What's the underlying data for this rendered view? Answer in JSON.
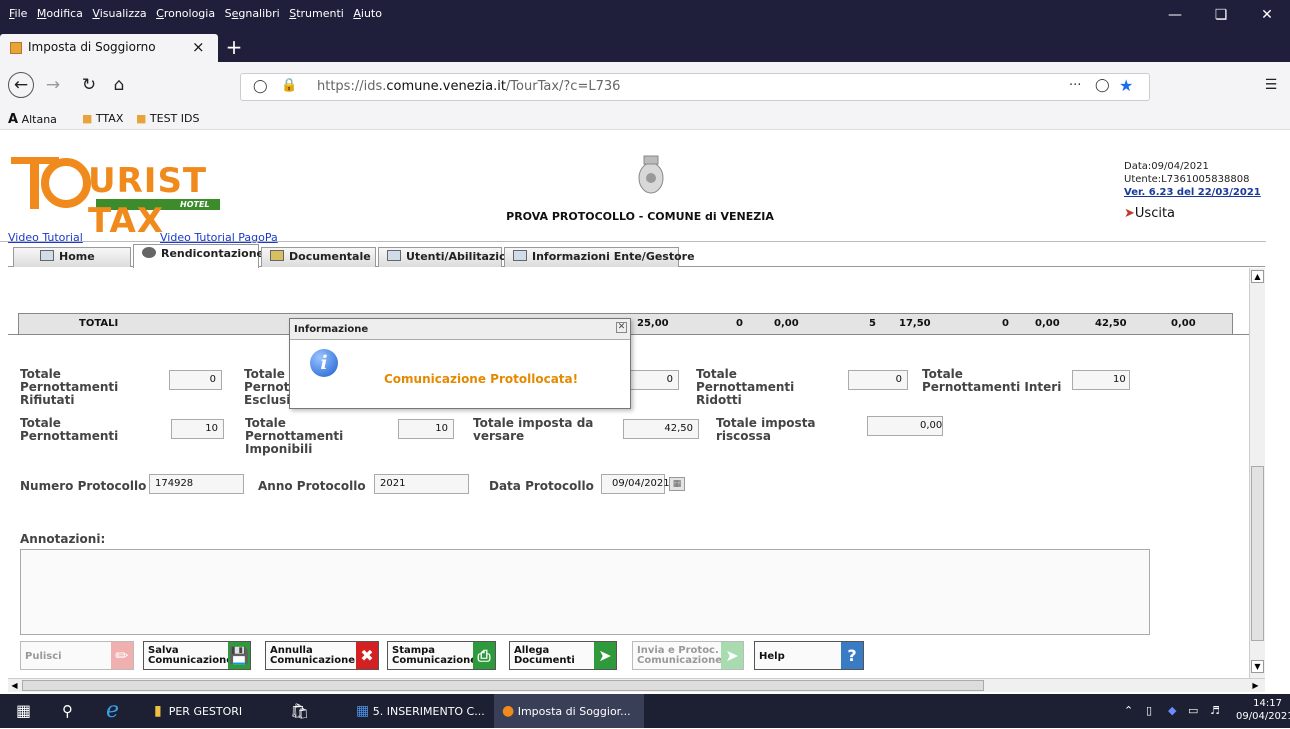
{
  "firefox": {
    "menu": [
      {
        "pre": "",
        "u": "F",
        "post": "ile"
      },
      {
        "pre": "",
        "u": "M",
        "post": "odifica"
      },
      {
        "pre": "",
        "u": "V",
        "post": "isualizza"
      },
      {
        "pre": "",
        "u": "C",
        "post": "ronologia"
      },
      {
        "pre": "S",
        "u": "e",
        "post": "gnalibri"
      },
      {
        "pre": "",
        "u": "S",
        "post": "trumenti"
      },
      {
        "pre": "",
        "u": "A",
        "post": "iuto"
      }
    ],
    "tab_title": "Imposta di Soggiorno",
    "url_prefix": "https://ids.",
    "url_domain": "comune.venezia.it",
    "url_path": "/TourTax/?c=L736",
    "bookmarks": [
      "Altana",
      "TTAX",
      "TEST IDS"
    ],
    "page_actions": "···"
  },
  "header": {
    "logo_text": "URIST TAX",
    "logo_sub": "HOTEL",
    "org": "PROVA PROTOCOLLO - COMUNE di VENEZIA",
    "data": "Data:09/04/2021",
    "utente": "Utente:L7361005838808",
    "version": "Ver. 6.23 del 22/03/2021",
    "uscita": "Uscita",
    "video_tutorial": "Video Tutorial",
    "video_pagopa": "Video Tutorial PagoPa"
  },
  "tabs": [
    "Home",
    "Rendicontazione",
    "Documentale",
    "Utenti/Abilitazioni",
    "Informazioni Ente/Gestore"
  ],
  "totals": {
    "label": "TOTALI",
    "values": [
      "25,00",
      "0",
      "0,00",
      "5",
      "17,50",
      "0",
      "0,00",
      "42,50",
      "0,00"
    ]
  },
  "form": {
    "rifiutati_label": "Totale Pernottamenti Rifiutati",
    "rifiutati_val": "0",
    "esclusi_label": "Totale Pernottamenti Esclusi",
    "col3_val": "0",
    "ridotti_label": "Totale Pernottamenti Ridotti",
    "ridotti_val": "0",
    "interi_label": "Totale Pernottamenti Interi",
    "interi_val": "10",
    "pernott_label": "Totale Pernottamenti",
    "pernott_val": "10",
    "imponibili_label": "Totale Pernottamenti Imponibili",
    "imponibili_val": "10",
    "versare_label": "Totale imposta da versare",
    "versare_val": "42,50",
    "riscossa_label": "Totale imposta riscossa",
    "riscossa_val": "0,00",
    "numero_label": "Numero Protocollo",
    "numero_val": "174928",
    "anno_label": "Anno Protocollo",
    "anno_val": "2021",
    "data_label": "Data Protocollo",
    "data_val": "09/04/2021",
    "annot_label": "Annotazioni:"
  },
  "buttons": {
    "pulisci": "Pulisci",
    "salva": [
      "Salva",
      "Comunicazione"
    ],
    "annulla": [
      "Annulla",
      "Comunicazione"
    ],
    "stampa": [
      "Stampa",
      "Comunicazione"
    ],
    "allega": [
      "Allega",
      "Documenti"
    ],
    "invia": [
      "Invia e Protoc.",
      "Comunicazione"
    ],
    "help": "Help"
  },
  "dialog": {
    "title": "Informazione",
    "message": "Comunicazione Protollocata!",
    "icon_letter": "i"
  },
  "taskbar": {
    "items": [
      "PER GESTORI",
      "5. INSERIMENTO C...",
      "Imposta di Soggior..."
    ],
    "time": "14:17",
    "date": "09/04/2021"
  },
  "colors": {
    "accent_orange": "#e58a00",
    "logo_orange": "#f08a1c",
    "logo_green": "#3c8c2c",
    "taskbar": "#1c2032",
    "firefox_dark": "#1f1f3c"
  }
}
